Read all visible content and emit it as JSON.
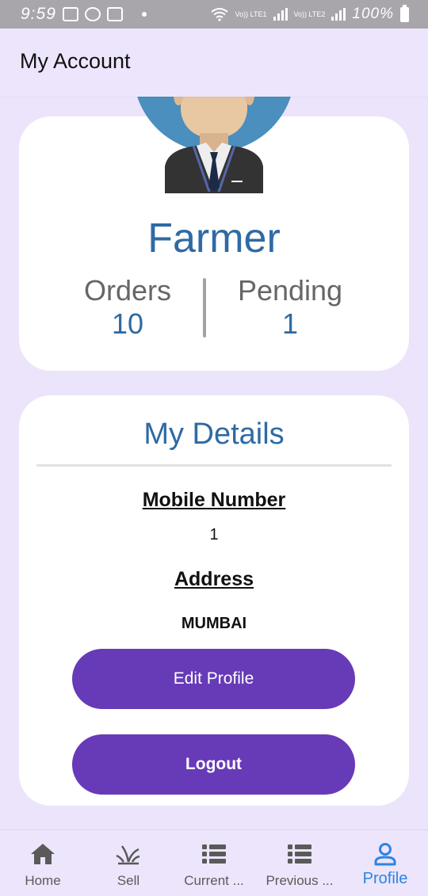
{
  "status_bar": {
    "time": "9:59",
    "net1": "Vo)) LTE1",
    "net2": "Vo)) LTE2",
    "battery": "100%"
  },
  "app_bar": {
    "title": "My Account"
  },
  "profile": {
    "name": "Farmer",
    "orders_label": "Orders",
    "orders_value": "10",
    "pending_label": "Pending",
    "pending_value": "1"
  },
  "details": {
    "title": "My Details",
    "mobile_label": "Mobile Number",
    "mobile_value": "1",
    "address_label": "Address",
    "address_value": "MUMBAI",
    "edit_button": "Edit Profile",
    "logout_button": "Logout"
  },
  "bottom_nav": {
    "items": [
      {
        "label": "Home",
        "icon": "home-icon"
      },
      {
        "label": "Sell",
        "icon": "sprout-icon"
      },
      {
        "label": "Current ...",
        "icon": "list-icon"
      },
      {
        "label": "Previous ...",
        "icon": "list-icon"
      },
      {
        "label": "Profile",
        "icon": "person-icon"
      }
    ],
    "active_index": 4
  },
  "colors": {
    "background": "#ece4fb",
    "accent_blue": "#2f6aa3",
    "button_purple": "#673ab7",
    "nav_active": "#2b84e4"
  }
}
